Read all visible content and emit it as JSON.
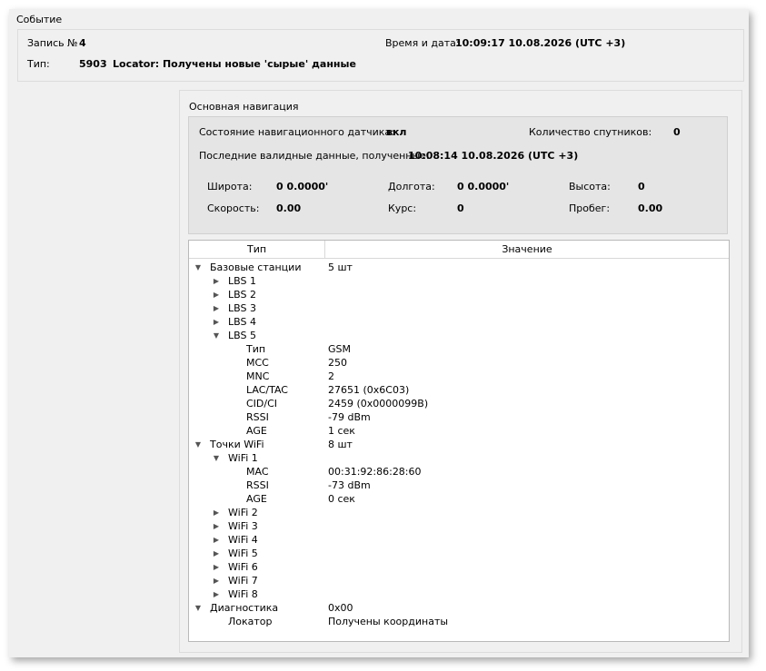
{
  "event": {
    "group_title": "Событие",
    "record_label": "Запись №",
    "record_value": "4",
    "datetime_label": "Время и дата:",
    "datetime_value": "10:09:17 10.08.2026 (UTC +3)",
    "type_label": "Тип:",
    "type_code": "5903",
    "type_text": "Locator: Получены новые 'сырые' данные"
  },
  "nav": {
    "group_title": "Основная навигация",
    "sensor_label": "Состояние навигационного датчика:",
    "sensor_value": "вкл",
    "sat_label": "Количество спутников:",
    "sat_value": "0",
    "last_valid_label": "Последние валидные данные, полученные:",
    "last_valid_value": "10:08:14 10.08.2026 (UTC +3)",
    "lat_label": "Широта:",
    "lat_value": "0 0.0000'",
    "lon_label": "Долгота:",
    "lon_value": "0 0.0000'",
    "alt_label": "Высота:",
    "alt_value": "0",
    "speed_label": "Скорость:",
    "speed_value": "0.00",
    "course_label": "Курс:",
    "course_value": "0",
    "mileage_label": "Пробег:",
    "mileage_value": "0.00"
  },
  "tree": {
    "col_type": "Тип",
    "col_value": "Значение",
    "rows": [
      {
        "depth": 0,
        "state": "expanded",
        "name": "Базовые станции",
        "value": "5 шт"
      },
      {
        "depth": 1,
        "state": "collapsed",
        "name": "LBS 1",
        "value": ""
      },
      {
        "depth": 1,
        "state": "collapsed",
        "name": "LBS 2",
        "value": ""
      },
      {
        "depth": 1,
        "state": "collapsed",
        "name": "LBS 3",
        "value": ""
      },
      {
        "depth": 1,
        "state": "collapsed",
        "name": "LBS 4",
        "value": ""
      },
      {
        "depth": 1,
        "state": "expanded",
        "name": "LBS 5",
        "value": ""
      },
      {
        "depth": 2,
        "state": "leaf",
        "name": "Тип",
        "value": "GSM"
      },
      {
        "depth": 2,
        "state": "leaf",
        "name": "MCC",
        "value": "250"
      },
      {
        "depth": 2,
        "state": "leaf",
        "name": "MNC",
        "value": "2"
      },
      {
        "depth": 2,
        "state": "leaf",
        "name": "LAC/TAC",
        "value": "27651 (0x6C03)"
      },
      {
        "depth": 2,
        "state": "leaf",
        "name": "CID/CI",
        "value": "2459 (0x0000099B)"
      },
      {
        "depth": 2,
        "state": "leaf",
        "name": "RSSI",
        "value": "-79 dBm"
      },
      {
        "depth": 2,
        "state": "leaf",
        "name": "AGE",
        "value": "1 сек"
      },
      {
        "depth": 0,
        "state": "expanded",
        "name": "Точки WiFi",
        "value": "8 шт"
      },
      {
        "depth": 1,
        "state": "expanded",
        "name": "WiFi 1",
        "value": ""
      },
      {
        "depth": 2,
        "state": "leaf",
        "name": "MAC",
        "value": "00:31:92:86:28:60"
      },
      {
        "depth": 2,
        "state": "leaf",
        "name": "RSSI",
        "value": "-73 dBm"
      },
      {
        "depth": 2,
        "state": "leaf",
        "name": "AGE",
        "value": "0 сек"
      },
      {
        "depth": 1,
        "state": "collapsed",
        "name": "WiFi 2",
        "value": ""
      },
      {
        "depth": 1,
        "state": "collapsed",
        "name": "WiFi 3",
        "value": ""
      },
      {
        "depth": 1,
        "state": "collapsed",
        "name": "WiFi 4",
        "value": ""
      },
      {
        "depth": 1,
        "state": "collapsed",
        "name": "WiFi 5",
        "value": ""
      },
      {
        "depth": 1,
        "state": "collapsed",
        "name": "WiFi 6",
        "value": ""
      },
      {
        "depth": 1,
        "state": "collapsed",
        "name": "WiFi 7",
        "value": ""
      },
      {
        "depth": 1,
        "state": "collapsed",
        "name": "WiFi 8",
        "value": ""
      },
      {
        "depth": 0,
        "state": "expanded",
        "name": "Диагностика",
        "value": "0x00"
      },
      {
        "depth": 1,
        "state": "leaf",
        "name": "Локатор",
        "value": "Получены координаты"
      }
    ]
  }
}
